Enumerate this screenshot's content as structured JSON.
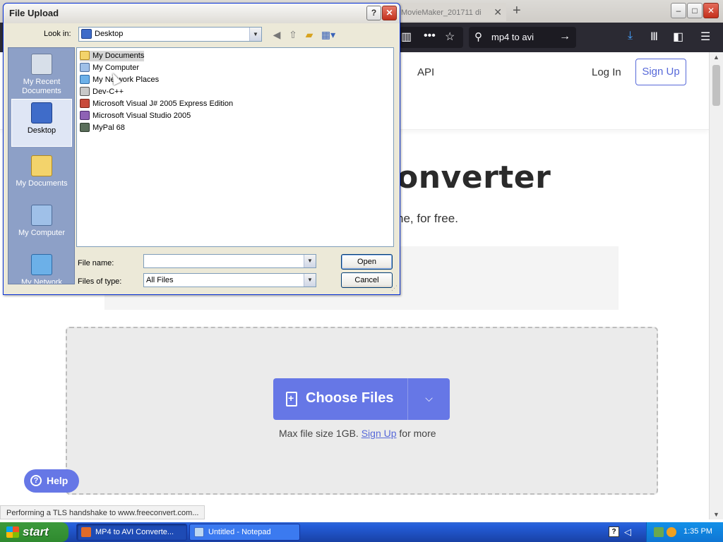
{
  "browser": {
    "tab_label": "MovieMaker_201711 di",
    "search_query": "mp4 to avi",
    "nav_icons": [
      "more-icon",
      "bookmark-star-icon",
      "download-icon",
      "library-icon",
      "sidebar-icon",
      "menu-icon"
    ]
  },
  "site": {
    "nav_api": "API",
    "nav_login": "Log In",
    "nav_signup": "Sign Up",
    "hero_title": "onverter",
    "hero_subtitle": "ne, for free.",
    "choose_files": "Choose Files",
    "max_size_prefix": "Max file size 1GB.",
    "max_size_link": "Sign Up",
    "max_size_suffix": "for more",
    "help": "Help",
    "status": "Performing a TLS handshake to www.freeconvert.com...",
    "accent_color": "#6677e6"
  },
  "dialog": {
    "title": "File Upload",
    "look_in_label": "Look in:",
    "look_in_value": "Desktop",
    "places": [
      {
        "label": "My Recent Documents"
      },
      {
        "label": "Desktop"
      },
      {
        "label": "My Documents"
      },
      {
        "label": "My Computer"
      },
      {
        "label": "My Network"
      }
    ],
    "files": [
      {
        "name": "My Documents"
      },
      {
        "name": "My Computer"
      },
      {
        "name": "My Network Places"
      },
      {
        "name": "Dev-C++"
      },
      {
        "name": "Microsoft Visual J# 2005 Express Edition"
      },
      {
        "name": "Microsoft Visual Studio 2005"
      },
      {
        "name": "MyPal 68"
      }
    ],
    "file_name_label": "File name:",
    "file_name_value": "",
    "files_of_type_label": "Files of type:",
    "files_of_type_value": "All Files",
    "open_button": "Open",
    "cancel_button": "Cancel"
  },
  "taskbar": {
    "start": "start",
    "tasks": [
      {
        "label": "MP4 to AVI Converte..."
      },
      {
        "label": "Untitled - Notepad"
      }
    ],
    "clock": "1:35 PM"
  }
}
